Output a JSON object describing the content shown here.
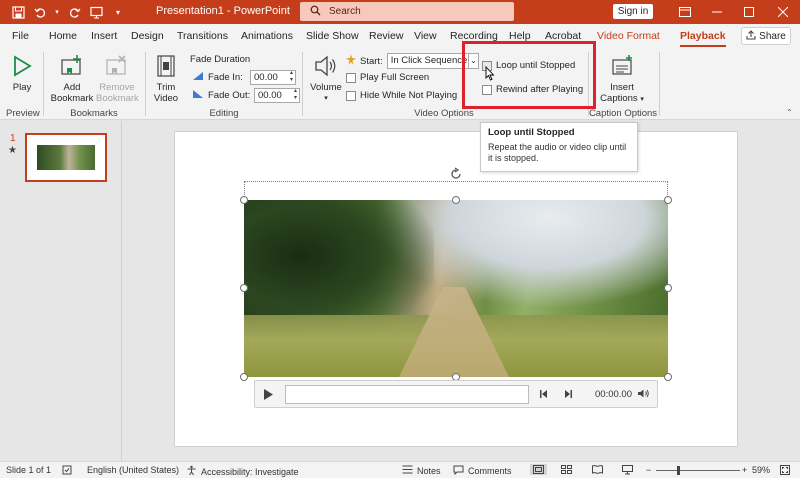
{
  "titlebar": {
    "title": "Presentation1 - PowerPoint",
    "search_placeholder": "Search",
    "sign_in": "Sign in",
    "bg_color": "#c43e1c"
  },
  "tabs": [
    {
      "label": "File"
    },
    {
      "label": "Home"
    },
    {
      "label": "Insert"
    },
    {
      "label": "Design"
    },
    {
      "label": "Transitions"
    },
    {
      "label": "Animations"
    },
    {
      "label": "Slide Show"
    },
    {
      "label": "Review"
    },
    {
      "label": "View"
    },
    {
      "label": "Recording"
    },
    {
      "label": "Help"
    },
    {
      "label": "Acrobat"
    },
    {
      "label": "Video Format"
    },
    {
      "label": "Playback"
    }
  ],
  "share_label": "Share",
  "ribbon": {
    "preview": {
      "play_label": "Play",
      "group": "Preview"
    },
    "bookmarks": {
      "add_label": "Add\nBookmark",
      "add_l1": "Add",
      "add_l2": "Bookmark",
      "remove_l1": "Remove",
      "remove_l2": "Bookmark",
      "group": "Bookmarks"
    },
    "editing": {
      "trim_l1": "Trim",
      "trim_l2": "Video",
      "fade_duration": "Fade Duration",
      "fade_in_label": "Fade In:",
      "fade_in_value": "00.00",
      "fade_out_label": "Fade Out:",
      "fade_out_value": "00.00",
      "group": "Editing"
    },
    "video_options": {
      "volume_label": "Volume",
      "start_label": "Start:",
      "start_value": "In Click Sequence",
      "play_full_screen": "Play Full Screen",
      "hide_while_not_playing": "Hide While Not Playing",
      "loop_until_stopped": "Loop until Stopped",
      "rewind_after_playing": "Rewind after Playing",
      "group": "Video Options"
    },
    "caption_options": {
      "insert_l1": "Insert",
      "insert_l2": "Captions",
      "group": "Caption Options"
    }
  },
  "tooltip": {
    "title": "Loop until Stopped",
    "body": "Repeat the audio or video clip until it is stopped."
  },
  "thumbnails": {
    "number": "1",
    "star": "★"
  },
  "media_bar": {
    "time": "00:00.00"
  },
  "statusbar": {
    "slide_info": "Slide 1 of 1",
    "language": "English (United States)",
    "accessibility": "Accessibility: Investigate",
    "notes": "Notes",
    "comments": "Comments",
    "zoom": "59%",
    "zoom_fraction": 0.59
  },
  "colors": {
    "accent": "#c43e1c",
    "highlight": "#e0202a"
  }
}
